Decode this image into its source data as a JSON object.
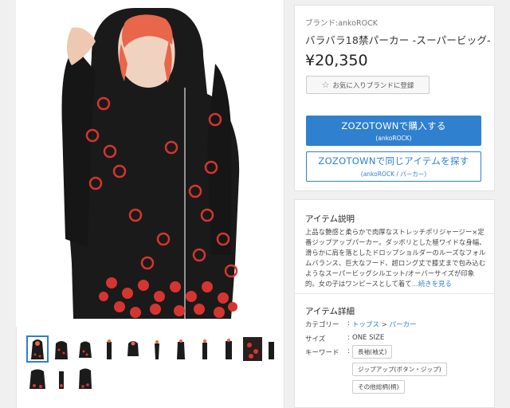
{
  "product": {
    "brand_label": "ブランド:ankoROCK",
    "title": "バラバラ18禁パーカー -スーパービッグ-",
    "price": "¥20,350"
  },
  "favorite": {
    "label": "お気に入りブランドに登録",
    "icon": "star-icon"
  },
  "buy_button": {
    "label": "ZOZOTOWNで購入する",
    "sub": "(ankoROCK)",
    "color": "#2f80cf"
  },
  "search_button": {
    "label": "ZOZOTOWNで同じアイテムを探す",
    "sub": "(ankoROCK / パーカー)"
  },
  "description": {
    "title": "アイテム説明",
    "text": "上品な艶感と柔らかで肉厚なストレッチポリジャージー×定番ジップアップパーカー。ダッボリとした極ワイドな身幅、滑らかに肩を落としたドロップショルダーのルーズなフォルムバランス、巨大なフード、超ロング丈で膝丈まで包み込むようなスーパービッグシルエット/オーバーサイズが印象的。女の子はワンピースとして着て",
    "read_more": "...続きを見る"
  },
  "details": {
    "title": "アイテム詳細",
    "category_label": "カテゴリー",
    "category_parent": "トップス",
    "category_sep": ">",
    "category_child": "パーカー",
    "size_label": "サイズ",
    "size_value": "ONE SIZE",
    "keyword_label": "キーワード",
    "colon": ":",
    "keywords": [
      "長袖(袖丈)",
      "ジップアップ(ボタン・ジップ)",
      "その他総柄(柄)"
    ]
  }
}
